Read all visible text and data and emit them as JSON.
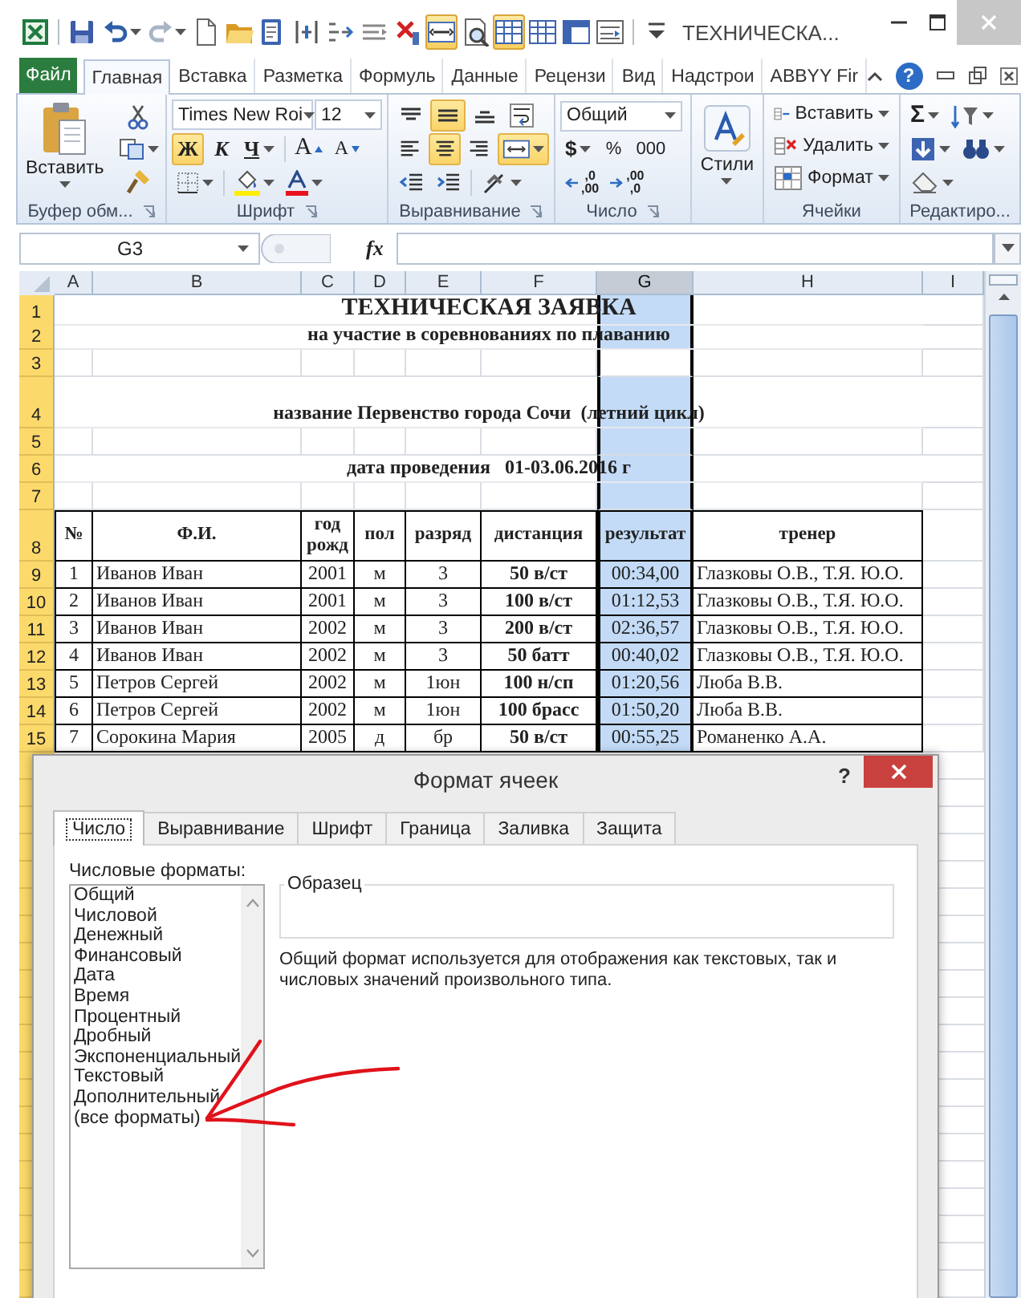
{
  "window": {
    "title": "ТЕХНИЧЕСКА..."
  },
  "quick_access": [
    {
      "kind": "excel",
      "on": false
    },
    {
      "kind": "save",
      "on": false
    },
    {
      "kind": "undo",
      "on": false
    },
    {
      "kind": "redo",
      "on": false
    },
    {
      "kind": "new",
      "on": false
    },
    {
      "kind": "open",
      "on": false
    },
    {
      "kind": "spelling",
      "on": false
    },
    {
      "kind": "distribute",
      "on": false
    },
    {
      "kind": "indent",
      "on": false
    },
    {
      "kind": "outdent",
      "on": false
    },
    {
      "kind": "delete",
      "on": false
    },
    {
      "kind": "merge",
      "on": true
    },
    {
      "kind": "preview",
      "on": false
    },
    {
      "kind": "grid",
      "on": true
    },
    {
      "kind": "grid",
      "on": false
    },
    {
      "kind": "freeze",
      "on": false
    },
    {
      "kind": "split",
      "on": false
    },
    {
      "kind": "customize",
      "on": false
    }
  ],
  "ribbon_tabs": [
    {
      "label": "Файл",
      "kind": "file",
      "selected": false
    },
    {
      "label": "Главная",
      "kind": "tab",
      "selected": true
    },
    {
      "label": "Вставка",
      "kind": "tab",
      "selected": false
    },
    {
      "label": "Разметка",
      "kind": "tab",
      "selected": false
    },
    {
      "label": "Формуль",
      "kind": "tab",
      "selected": false
    },
    {
      "label": "Данные",
      "kind": "tab",
      "selected": false
    },
    {
      "label": "Рецензи",
      "kind": "tab",
      "selected": false
    },
    {
      "label": "Вид",
      "kind": "tab",
      "selected": false
    },
    {
      "label": "Надстрои",
      "kind": "tab",
      "selected": false
    },
    {
      "label": "ABBYY Fir",
      "kind": "tab",
      "selected": false
    }
  ],
  "help": "?",
  "ribbon": {
    "clipboard": {
      "paste": "Вставить",
      "label": "Буфер обм..."
    },
    "font": {
      "name": "Times New Roi",
      "size": "12",
      "bold": "Ж",
      "bold_on": true,
      "italic": "К",
      "underline": "Ч",
      "grow": "A",
      "shrink": "A",
      "label": "Шрифт"
    },
    "alignment": {
      "rows": [
        [
          {
            "kind": "top",
            "on": false
          },
          {
            "kind": "middle",
            "on": true
          },
          {
            "kind": "bottom",
            "on": false
          },
          {
            "kind": "wrap",
            "on": false
          }
        ],
        [
          {
            "kind": "left",
            "on": false
          },
          {
            "kind": "center",
            "on": true
          },
          {
            "kind": "right",
            "on": false
          },
          {
            "kind": "merge",
            "on": true
          }
        ],
        [
          {
            "kind": "outdent",
            "on": false
          },
          {
            "kind": "indent",
            "on": false
          },
          {
            "kind": "orientation",
            "on": false
          }
        ]
      ],
      "label": "Выравнивание"
    },
    "number": {
      "format": "Общий",
      "currency": "$",
      "percent": "%",
      "thousands": "000",
      "increase_decimal": [
        ",0",
        ",00"
      ],
      "decrease_decimal": [
        ",00",
        ",0"
      ],
      "label": "Число"
    },
    "styles": {
      "label": "Стили"
    },
    "cells": {
      "insert": "Вставить",
      "delete": "Удалить",
      "format": "Формат",
      "label": "Ячейки"
    },
    "editing": {
      "sum": "Σ",
      "label": "Редактиро..."
    }
  },
  "formula_bar": {
    "name_box": "G3",
    "function_label": "fx"
  },
  "sheet": {
    "columns": [
      {
        "label": "A",
        "selected": false
      },
      {
        "label": "B",
        "selected": false
      },
      {
        "label": "C",
        "selected": false
      },
      {
        "label": "D",
        "selected": false
      },
      {
        "label": "E",
        "selected": false
      },
      {
        "label": "F",
        "selected": false
      },
      {
        "label": "G",
        "selected": true
      },
      {
        "label": "H",
        "selected": false
      },
      {
        "label": "I",
        "selected": false
      }
    ],
    "rows": [
      {
        "number": "1",
        "selected": true,
        "kind": "title",
        "text": "ТЕХНИЧЕСКАЯ ЗАЯВКА"
      },
      {
        "number": "2",
        "selected": true,
        "kind": "subtitle",
        "text": "на участие в соревнованиях по плаванию"
      },
      {
        "number": "3",
        "selected": true,
        "kind": "blank",
        "active": true
      },
      {
        "number": "4",
        "selected": true,
        "kind": "subtitle",
        "tall": true,
        "text": "название Первенство города Сочи  (летний цикл)"
      },
      {
        "number": "5",
        "selected": true,
        "kind": "blank"
      },
      {
        "number": "6",
        "selected": true,
        "kind": "subtitle",
        "text": "дата проведения   01-03.06.2016 г"
      },
      {
        "number": "7",
        "selected": true,
        "kind": "blank"
      },
      {
        "number": "8",
        "selected": true,
        "kind": "header",
        "tall": true,
        "cells": [
          "№",
          "Ф.И.",
          "год рожд",
          "пол",
          "разряд",
          "дистанция",
          "результат",
          "тренер"
        ]
      },
      {
        "number": "9",
        "selected": true,
        "kind": "data",
        "cells": [
          "1",
          "Иванов Иван",
          "2001",
          "м",
          "3",
          "50 в/ст",
          "00:34,00",
          "Глазковы О.В., Т.Я. Ю.О."
        ]
      },
      {
        "number": "10",
        "selected": true,
        "kind": "data",
        "cells": [
          "2",
          "Иванов Иван",
          "2001",
          "м",
          "3",
          "100 в/ст",
          "01:12,53",
          "Глазковы О.В., Т.Я. Ю.О."
        ]
      },
      {
        "number": "11",
        "selected": true,
        "kind": "data",
        "cells": [
          "3",
          "Иванов Иван",
          "2002",
          "м",
          "3",
          "200 в/ст",
          "02:36,57",
          "Глазковы О.В., Т.Я. Ю.О."
        ]
      },
      {
        "number": "12",
        "selected": true,
        "kind": "data",
        "cells": [
          "4",
          "Иванов Иван",
          "2002",
          "м",
          "3",
          "50 батт",
          "00:40,02",
          "Глазковы О.В., Т.Я. Ю.О."
        ]
      },
      {
        "number": "13",
        "selected": true,
        "kind": "data",
        "cells": [
          "5",
          "Петров Сергей",
          "2002",
          "м",
          "1юн",
          "100 н/сп",
          "01:20,56",
          "Люба В.В."
        ]
      },
      {
        "number": "14",
        "selected": true,
        "kind": "data",
        "cells": [
          "6",
          "Петров Сергей",
          "2002",
          "м",
          "1юн",
          "100 брасс",
          "01:50,20",
          "Люба В.В."
        ]
      },
      {
        "number": "15",
        "selected": true,
        "kind": "data",
        "cells": [
          "7",
          "Сорокина Мария",
          "2005",
          "д",
          "бр",
          "50 в/ст",
          "00:55,25",
          "Романенко А.А."
        ]
      }
    ]
  },
  "dialog": {
    "title": "Формат ячеек",
    "help": "?",
    "tabs": [
      {
        "label": "Число",
        "selected": true
      },
      {
        "label": "Выравнивание",
        "selected": false
      },
      {
        "label": "Шрифт",
        "selected": false
      },
      {
        "label": "Граница",
        "selected": false
      },
      {
        "label": "Заливка",
        "selected": false
      },
      {
        "label": "Защита",
        "selected": false
      }
    ],
    "formats_label": "Числовые форматы:",
    "formats": [
      {
        "label": "Общий",
        "selected": false
      },
      {
        "label": "Числовой",
        "selected": false
      },
      {
        "label": "Денежный",
        "selected": false
      },
      {
        "label": "Финансовый",
        "selected": false
      },
      {
        "label": "Дата",
        "selected": false
      },
      {
        "label": "Время",
        "selected": false
      },
      {
        "label": "Процентный",
        "selected": false
      },
      {
        "label": "Дробный",
        "selected": false
      },
      {
        "label": "Экспоненциальный",
        "selected": false
      },
      {
        "label": "Текстовый",
        "selected": false
      },
      {
        "label": "Дополнительный",
        "selected": false
      },
      {
        "label": "(все форматы)",
        "selected": false
      }
    ],
    "sample_label": "Образец",
    "description": "Общий формат используется для отображения как текстовых, так и числовых значений произвольного типа."
  },
  "annotations": [
    {
      "kind": "arrow"
    }
  ]
}
